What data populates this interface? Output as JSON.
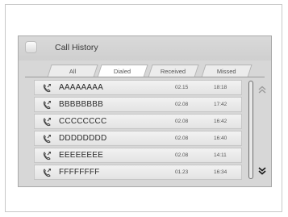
{
  "header": {
    "title": "Call History",
    "icon": "phone-app-icon"
  },
  "tabs": [
    {
      "label": "All",
      "active": false
    },
    {
      "label": "Dialed",
      "active": true
    },
    {
      "label": "Received",
      "active": false
    },
    {
      "label": "Missed",
      "active": false
    }
  ],
  "calls": [
    {
      "name": "AAAAAAAA",
      "date": "02.15",
      "time": "18:18",
      "icon": "dialed-call-icon"
    },
    {
      "name": "BBBBBBBB",
      "date": "02.08",
      "time": "17:42",
      "icon": "dialed-call-icon"
    },
    {
      "name": "CCCCCCCC",
      "date": "02.08",
      "time": "16:42",
      "icon": "dialed-call-icon"
    },
    {
      "name": "DDDDDDDD",
      "date": "02.08",
      "time": "16:40",
      "icon": "dialed-call-icon"
    },
    {
      "name": "EEEEEEEE",
      "date": "02.08",
      "time": "14:11",
      "icon": "dialed-call-icon"
    },
    {
      "name": "FFFFFFFF",
      "date": "01.23",
      "time": "16:34",
      "icon": "dialed-call-icon"
    }
  ],
  "scroll": {
    "up_icon": "double-chevron-up-icon",
    "down_icon": "double-chevron-down-icon"
  },
  "colors": {
    "panel": "#d7d7d7",
    "row": "#eeeeee",
    "active_tab": "#ffffff"
  }
}
